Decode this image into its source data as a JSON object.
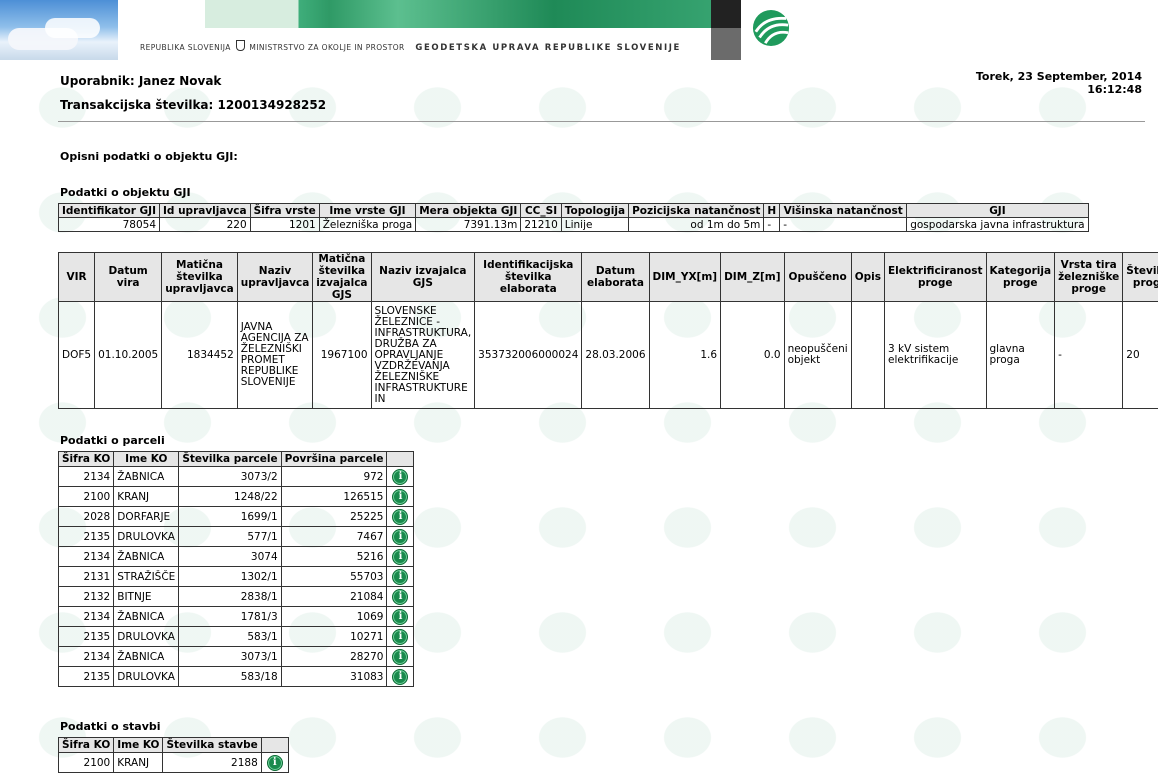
{
  "banner": {
    "republika": "REPUBLIKA SLOVENIJA",
    "ministrstvo": "MINISTRSTVO ZA OKOLJE IN PROSTOR",
    "gurs": "GEODETSKA UPRAVA REPUBLIKE SLOVENIJE"
  },
  "user": {
    "label": "Uporabnik:",
    "name": "Janez Novak"
  },
  "transaction": {
    "label": "Transakcijska številka:",
    "number": "1200134928252"
  },
  "datetime": {
    "date": "Torek, 23 September, 2014",
    "time": "16:12:48"
  },
  "heading": "Opisni podatki o objektu GJI:",
  "object": {
    "title": "Podatki o objektu GJI",
    "headers": [
      "Identifikator GJI",
      "Id upravljavca",
      "Šifra vrste",
      "Ime vrste GJI",
      "Mera objekta GJI",
      "CC_SI",
      "Topologija",
      "Pozicijska natančnost",
      "H",
      "Višinska natančnost",
      "GJI"
    ],
    "row": [
      "78054",
      "220",
      "1201",
      "Železniška proga",
      "7391.13m",
      "21210",
      "Linije",
      "od 1m do 5m",
      "-",
      "-",
      "gospodarska javna infrastruktura"
    ]
  },
  "vir": {
    "headers": [
      "VIR",
      "Datum vira",
      "Matična številka upravljavca",
      "Naziv upravljavca",
      "Matična številka izvajalca GJS",
      "Naziv izvajalca GJS",
      "Identifikacijska številka elaborata",
      "Datum elaborata",
      "DIM_YX[m]",
      "DIM_Z[m]",
      "Opuščeno",
      "Opis",
      "Elektrificiranost proge",
      "Kategorija proge",
      "Vrsta tira železniške proge",
      "Številka proge"
    ],
    "row": [
      "DOF5",
      "01.10.2005",
      "1834452",
      "JAVNA AGENCIJA ZA ŽELEZNIŠKI PROMET REPUBLIKE SLOVENIJE",
      "1967100",
      "SLOVENSKE ŽELEZNICE - INFRASTRUKTURA, DRUŽBA ZA OPRAVLJANJE VZDRŽEVANJA ŽELEZNIŠKE INFRASTRUKTURE IN",
      "353732006000024",
      "28.03.2006",
      "1.6",
      "0.0",
      "neopuščeni objekt",
      "",
      "3 kV sistem elektrifikacije",
      "glavna proga",
      "-",
      "20"
    ]
  },
  "parcels": {
    "title": "Podatki o parceli",
    "headers": [
      "Šifra KO",
      "Ime KO",
      "Številka parcele",
      "Površina parcele",
      ""
    ],
    "rows": [
      [
        "2134",
        "ŽABNICA",
        "3073/2",
        "972"
      ],
      [
        "2100",
        "KRANJ",
        "1248/22",
        "126515"
      ],
      [
        "2028",
        "DORFARJE",
        "1699/1",
        "25225"
      ],
      [
        "2135",
        "DRULOVKA",
        "577/1",
        "7467"
      ],
      [
        "2134",
        "ŽABNICA",
        "3074",
        "5216"
      ],
      [
        "2131",
        "STRAŽIŠČE",
        "1302/1",
        "55703"
      ],
      [
        "2132",
        "BITNJE",
        "2838/1",
        "21084"
      ],
      [
        "2134",
        "ŽABNICA",
        "1781/3",
        "1069"
      ],
      [
        "2135",
        "DRULOVKA",
        "583/1",
        "10271"
      ],
      [
        "2134",
        "ŽABNICA",
        "3073/1",
        "28270"
      ],
      [
        "2135",
        "DRULOVKA",
        "583/18",
        "31083"
      ]
    ]
  },
  "buildings": {
    "title": "Podatki o stavbi",
    "headers": [
      "Šifra KO",
      "Ime KO",
      "Številka stavbe",
      ""
    ],
    "rows": [
      [
        "2100",
        "KRANJ",
        "2188"
      ]
    ]
  },
  "icons": {
    "info": "info-icon",
    "info_glyph": "i",
    "logo": "gurs-logo-icon",
    "coat": "coat-of-arms-icon"
  },
  "colors": {
    "accent": "#1a8a4d",
    "header_bg": "#e6e6e6"
  }
}
